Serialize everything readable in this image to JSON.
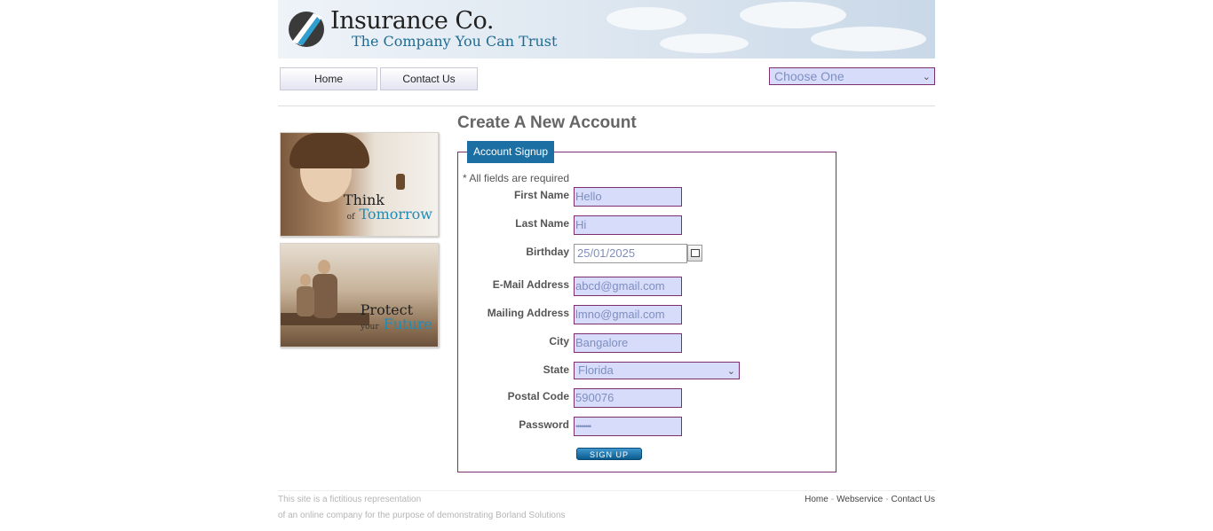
{
  "header": {
    "brand": "Insurance Co.",
    "tagline": "The Company You Can Trust"
  },
  "nav": {
    "home_label": "Home",
    "contact_label": "Contact Us",
    "choose_value": "Choose One"
  },
  "promos": [
    {
      "line1": "Think",
      "line2_small": "of",
      "line2_accent": "Tomorrow"
    },
    {
      "line1": "Protect",
      "line2_small": "your",
      "line2_accent": "Future"
    }
  ],
  "form": {
    "heading": "Create A New Account",
    "legend": "Account Signup",
    "required_note": "* All fields are required",
    "fields": {
      "first_name": {
        "label": "First Name",
        "value": "Hello"
      },
      "last_name": {
        "label": "Last Name",
        "value": "Hi"
      },
      "birthday": {
        "label": "Birthday",
        "value": "25/01/2025"
      },
      "email": {
        "label": "E-Mail Address",
        "value": "abcd@gmail.com"
      },
      "mailing": {
        "label": "Mailing Address",
        "value": "lmno@gmail.com"
      },
      "city": {
        "label": "City",
        "value": "Bangalore"
      },
      "state": {
        "label": "State",
        "value": "Florida"
      },
      "postal": {
        "label": "Postal Code",
        "value": "590076"
      },
      "password": {
        "label": "Password",
        "value": "••••••••"
      }
    },
    "signup_label": "SIGN UP"
  },
  "footer": {
    "note_line1": "This site is a fictitious representation",
    "note_line2": "of an online company for the purpose of demonstrating Borland Solutions",
    "links": [
      "Home",
      "Webservice",
      "Contact Us"
    ]
  },
  "colors": {
    "accent": "#1b6fa3",
    "input_bg": "#d7dcfb",
    "input_border": "#7b2f6e"
  }
}
